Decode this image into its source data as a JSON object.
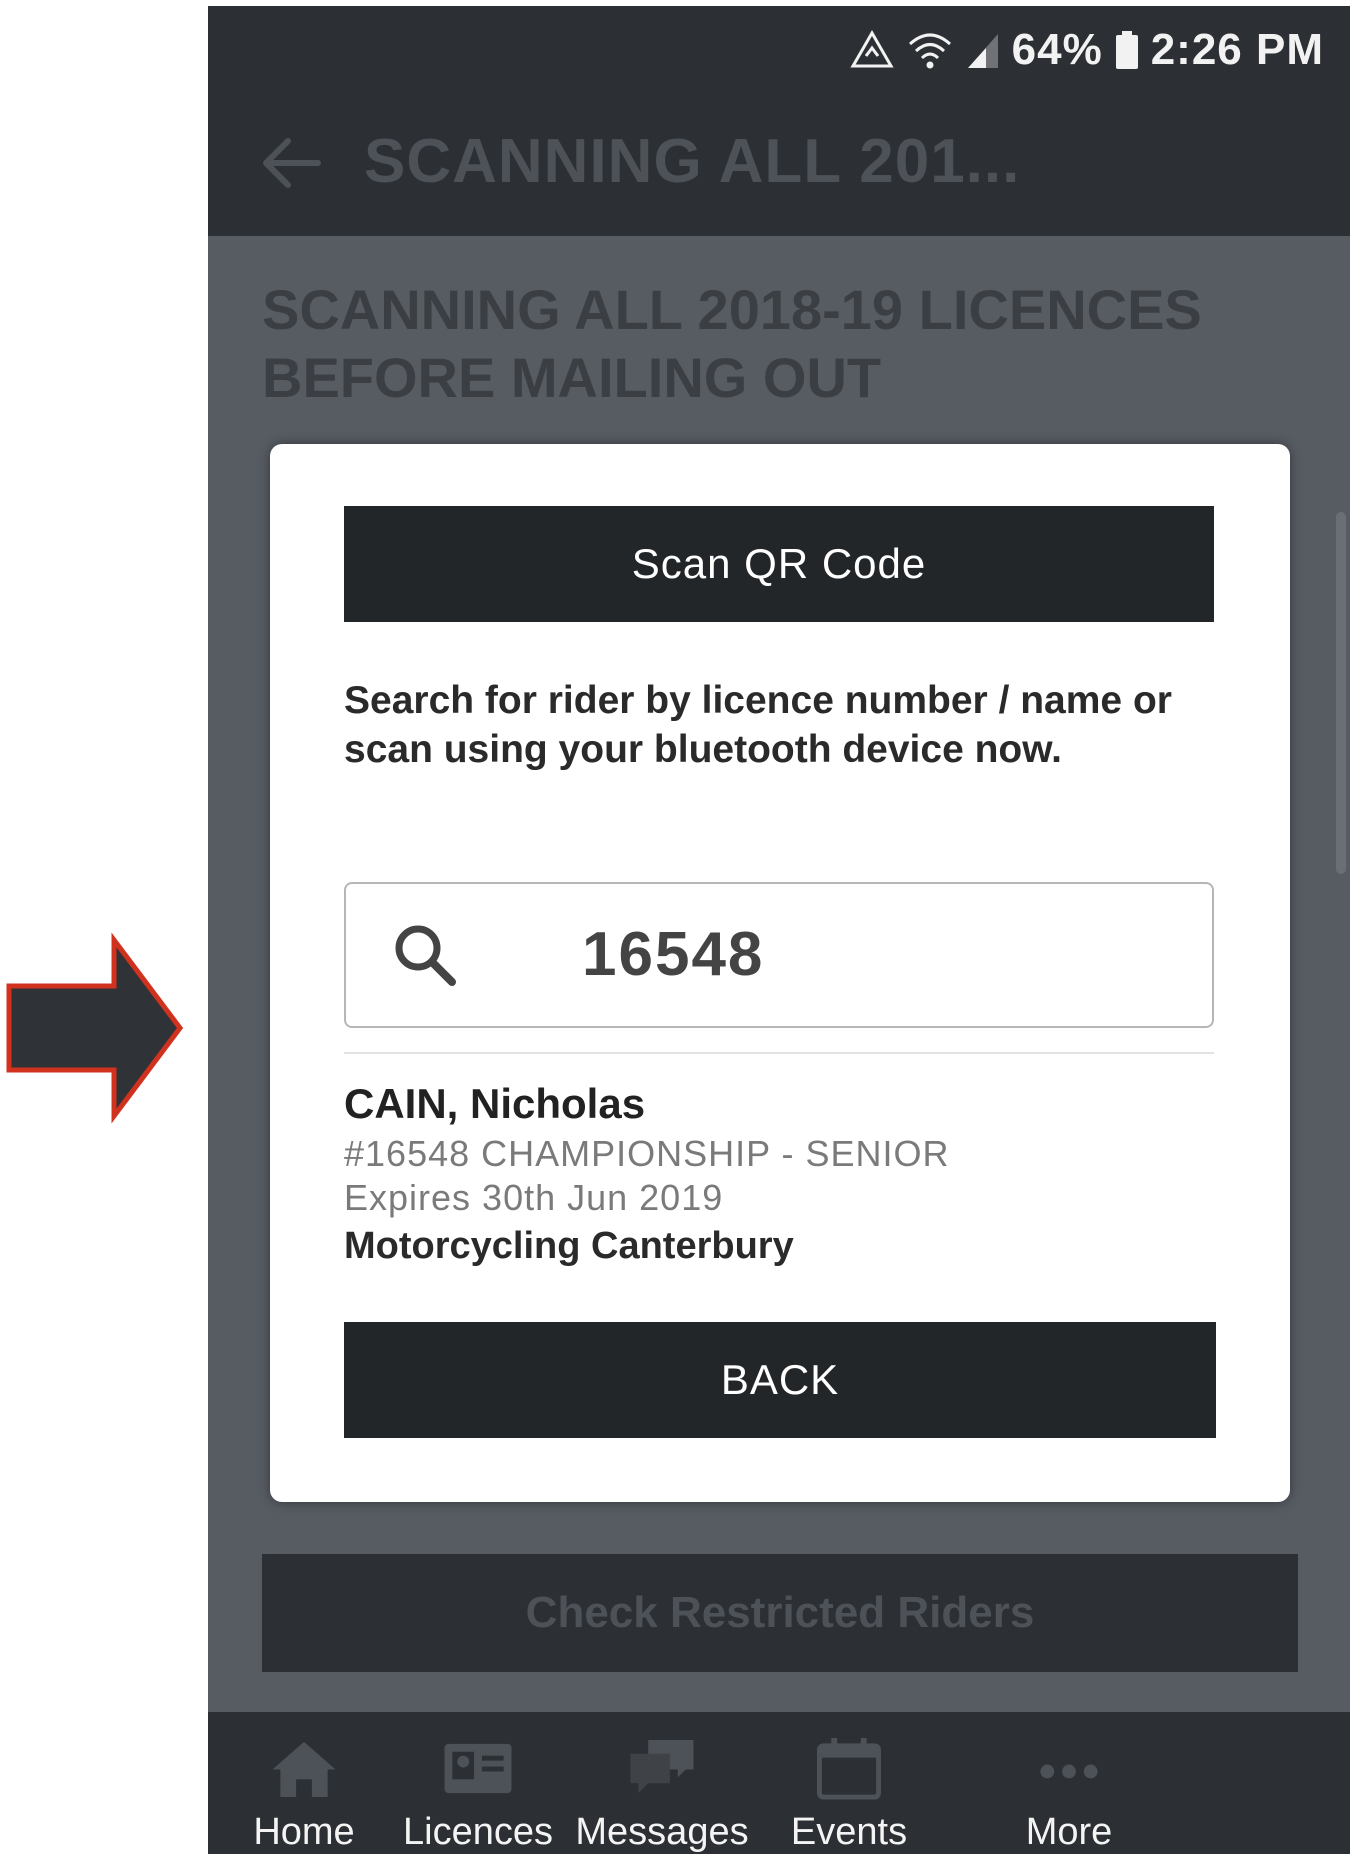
{
  "status_bar": {
    "battery_percent": "64%",
    "time": "2:26 PM",
    "icons": [
      "data-saver-icon",
      "wifi-icon",
      "signal-icon",
      "battery-icon"
    ]
  },
  "app_bar": {
    "title": "SCANNING ALL 201...",
    "back_icon": "back-arrow-icon"
  },
  "page": {
    "heading": "SCANNING ALL 2018-19 LICENCES BEFORE MAILING OUT",
    "check_restricted_label": "Check Restricted Riders"
  },
  "dialog": {
    "scan_button_label": "Scan QR Code",
    "instructions": "Search for rider by licence number / name or scan using your bluetooth device now.",
    "search": {
      "value": "16548",
      "icon": "search-icon"
    },
    "result": {
      "name": "CAIN, Nicholas",
      "licence": "#16548 CHAMPIONSHIP - SENIOR",
      "expiry": "Expires 30th Jun 2019",
      "club": "Motorcycling Canterbury"
    },
    "back_button_label": "BACK"
  },
  "bottom_nav": {
    "items": [
      {
        "label": "Home",
        "icon": "home-icon"
      },
      {
        "label": "Licences",
        "icon": "licence-card-icon"
      },
      {
        "label": "Messages",
        "icon": "messages-icon"
      },
      {
        "label": "Events",
        "icon": "calendar-icon"
      },
      {
        "label": "More",
        "icon": "more-dots-icon"
      }
    ]
  },
  "colors": {
    "annotation_arrow_fill": "#2f3236",
    "annotation_arrow_stroke": "#d0321e",
    "dialog_button_bg": "#232629",
    "overlay_bg": "#575c63"
  }
}
